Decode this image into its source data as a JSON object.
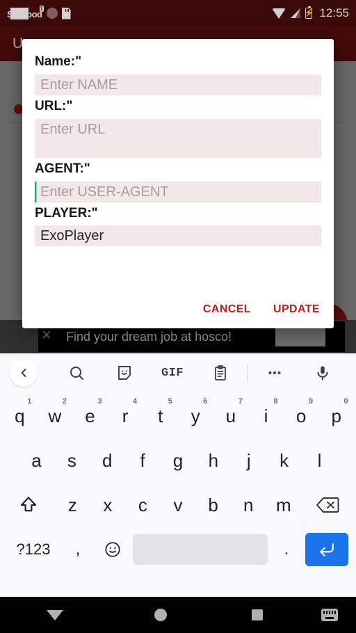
{
  "status_bar": {
    "notification_text": "S",
    "notification_text_2": "pod",
    "notification_badge": "1",
    "icons": [
      "podcast-icon",
      "circle-icon",
      "sd-card-icon"
    ],
    "wifi": "wifi-icon",
    "signal": "cell-signal-icon",
    "battery": "battery-charging-icon",
    "battery_glyph": "⚡",
    "clock": "12:55"
  },
  "app": {
    "title": "U",
    "background_color": "#808080",
    "app_bar_color": "#520d0d"
  },
  "dialog": {
    "fields": [
      {
        "label": "Name:\"",
        "placeholder": "Enter NAME",
        "value": "",
        "size": "short",
        "focused": false
      },
      {
        "label": "URL:\"",
        "placeholder": "Enter URL",
        "value": "",
        "size": "tall",
        "focused": false
      },
      {
        "label": "AGENT:\"",
        "placeholder": "Enter USER-AGENT",
        "value": "",
        "size": "short",
        "focused": true
      },
      {
        "label": "PLAYER:\"",
        "placeholder": "",
        "value": "ExoPlayer",
        "size": "short",
        "focused": false
      }
    ],
    "cancel_label": "CANCEL",
    "update_label": "UPDATE",
    "accent_color": "#b2201f",
    "input_background": "#f3e8e8",
    "caret_color": "#2e9e7a"
  },
  "ad": {
    "text": "Find your dream job at hosco!",
    "close_icon": "close-x-icon",
    "close_glyph": "✕"
  },
  "keyboard": {
    "toolbar": [
      {
        "name": "back-chevron-icon",
        "label": ""
      },
      {
        "name": "search-icon",
        "label": ""
      },
      {
        "name": "sticker-icon",
        "label": ""
      },
      {
        "name": "gif-icon",
        "label": "GIF"
      },
      {
        "name": "clipboard-icon",
        "label": ""
      },
      {
        "name": "more-options-icon",
        "label": ""
      },
      {
        "name": "microphone-icon",
        "label": ""
      }
    ],
    "row1": [
      {
        "key": "q",
        "num": "1"
      },
      {
        "key": "w",
        "num": "2"
      },
      {
        "key": "e",
        "num": "3"
      },
      {
        "key": "r",
        "num": "4"
      },
      {
        "key": "t",
        "num": "5"
      },
      {
        "key": "y",
        "num": "6"
      },
      {
        "key": "u",
        "num": "7"
      },
      {
        "key": "i",
        "num": "8"
      },
      {
        "key": "o",
        "num": "9"
      },
      {
        "key": "p",
        "num": "0"
      }
    ],
    "row2": [
      {
        "key": "a"
      },
      {
        "key": "s"
      },
      {
        "key": "d"
      },
      {
        "key": "f"
      },
      {
        "key": "g"
      },
      {
        "key": "h"
      },
      {
        "key": "j"
      },
      {
        "key": "k"
      },
      {
        "key": "l"
      }
    ],
    "row3": [
      {
        "key": "z"
      },
      {
        "key": "x"
      },
      {
        "key": "c"
      },
      {
        "key": "v"
      },
      {
        "key": "b"
      },
      {
        "key": "n"
      },
      {
        "key": "m"
      }
    ],
    "shift_label": "shift-icon",
    "backspace_label": "backspace-icon",
    "symbols_label": "?123",
    "comma_label": ",",
    "emoji_label": "emoji-icon",
    "space_label": "",
    "period_label": ".",
    "enter_label": "enter-icon",
    "enter_color": "#1a73e8"
  },
  "navbar": {
    "back_label": "back-down-icon",
    "home_label": "home-icon",
    "recents_label": "recents-icon",
    "keyboard_switch_label": "keyboard-switcher-icon"
  }
}
